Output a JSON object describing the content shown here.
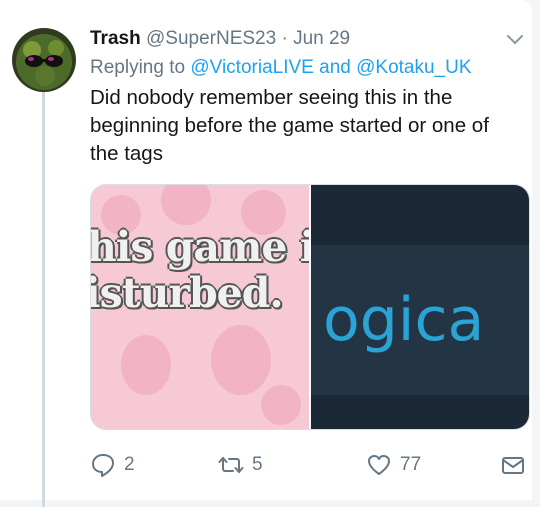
{
  "tweet": {
    "name": "Trash",
    "handle": "@SuperNES23",
    "separator": "·",
    "date": "Jun 29",
    "replying_prefix": "Replying to",
    "reply_user_1": "@VictoriaLIVE",
    "reply_and": "and",
    "reply_user_2": "@Kotaku_UK",
    "text": "Did nobody remember seeing this in the beginning before the game started or one of the tags",
    "media": {
      "left_line_1": "his game i",
      "left_line_2": "isturbed.",
      "right_word": "ogica"
    },
    "actions": {
      "reply_count": "2",
      "retweet_count": "5",
      "like_count": "77"
    },
    "icons": {
      "avatar": "avatar-image",
      "menu": "chevron-down-icon",
      "reply": "reply-icon",
      "retweet": "retweet-icon",
      "like": "heart-icon",
      "dm": "envelope-icon"
    },
    "colors": {
      "link": "#1da1f2",
      "muted": "#657786",
      "thread_line": "#cfd8dc"
    }
  }
}
